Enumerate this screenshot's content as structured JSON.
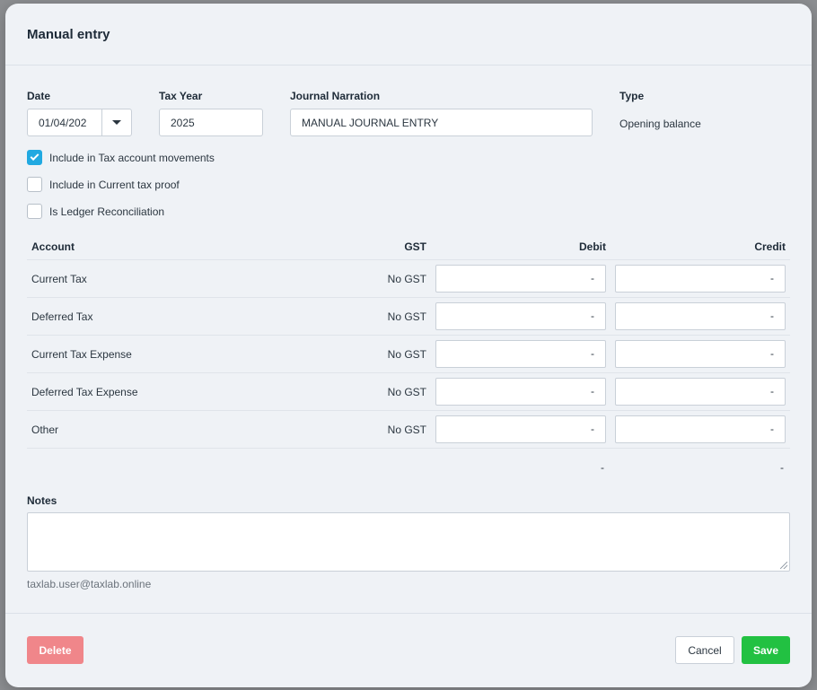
{
  "modal": {
    "title": "Manual entry"
  },
  "form": {
    "date": {
      "label": "Date",
      "value": "01/04/202"
    },
    "tax_year": {
      "label": "Tax Year",
      "value": "2025"
    },
    "journal_narration": {
      "label": "Journal Narration",
      "value": "MANUAL JOURNAL ENTRY"
    },
    "type": {
      "label": "Type",
      "value": "Opening balance"
    }
  },
  "checkboxes": [
    {
      "label": "Include in Tax account movements",
      "checked": true
    },
    {
      "label": "Include in Current tax proof",
      "checked": false
    },
    {
      "label": "Is Ledger Reconciliation",
      "checked": false
    }
  ],
  "table": {
    "headers": {
      "account": "Account",
      "gst": "GST",
      "debit": "Debit",
      "credit": "Credit"
    },
    "rows": [
      {
        "account": "Current Tax",
        "gst": "No GST",
        "debit": "-",
        "credit": "-"
      },
      {
        "account": "Deferred Tax",
        "gst": "No GST",
        "debit": "-",
        "credit": "-"
      },
      {
        "account": "Current Tax Expense",
        "gst": "No GST",
        "debit": "-",
        "credit": "-"
      },
      {
        "account": "Deferred Tax Expense",
        "gst": "No GST",
        "debit": "-",
        "credit": "-"
      },
      {
        "account": "Other",
        "gst": "No GST",
        "debit": "-",
        "credit": "-"
      }
    ],
    "totals": {
      "debit": "-",
      "credit": "-"
    }
  },
  "notes": {
    "label": "Notes",
    "value": "",
    "user": "taxlab.user@taxlab.online"
  },
  "footer": {
    "delete_label": "Delete",
    "cancel_label": "Cancel",
    "save_label": "Save"
  },
  "colors": {
    "checkbox_checked": "#21a9e1",
    "save": "#22c142",
    "delete": "#f0868a"
  }
}
